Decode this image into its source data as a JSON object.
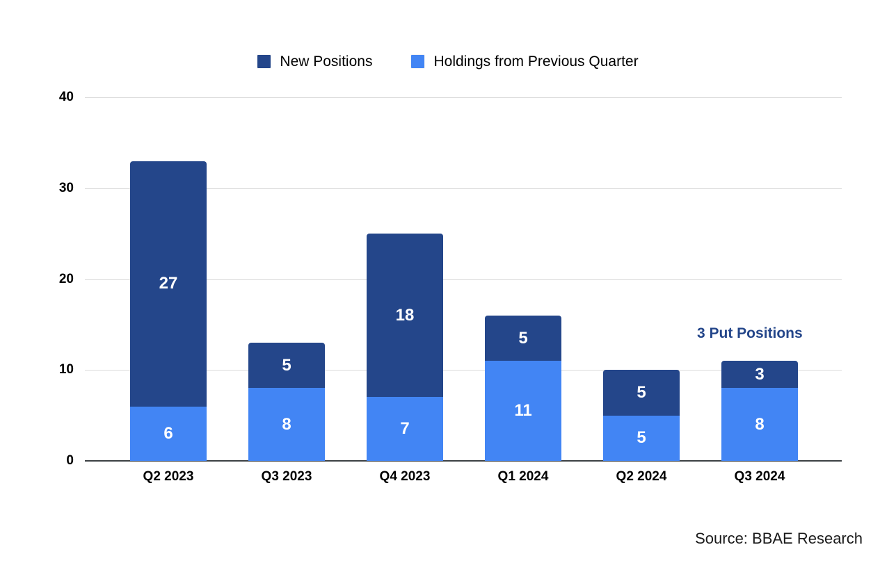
{
  "legend": {
    "entries": [
      {
        "label": "New Positions",
        "color": "#24468a"
      },
      {
        "label": "Holdings from Previous Quarter",
        "color": "#4285f4"
      }
    ]
  },
  "annotation": {
    "text": "3 Put Positions",
    "color": "#24468a"
  },
  "source": {
    "text": "Source: BBAE Research"
  },
  "chart_data": {
    "type": "bar",
    "stacked": true,
    "title": "",
    "xlabel": "",
    "ylabel": "",
    "ylim": [
      0,
      40
    ],
    "yticks": [
      0,
      10,
      20,
      30,
      40
    ],
    "ytick_labels": [
      "0",
      "10",
      "20",
      "30",
      "40"
    ],
    "grid": true,
    "legend_position": "top-center",
    "categories": [
      "Q2 2023",
      "Q3 2023",
      "Q4 2023",
      "Q1 2024",
      "Q2 2024",
      "Q3 2024"
    ],
    "series": [
      {
        "name": "Holdings from Previous Quarter",
        "color": "#4285f4",
        "values": [
          6,
          8,
          7,
          11,
          5,
          8
        ]
      },
      {
        "name": "New Positions",
        "color": "#24468a",
        "values": [
          27,
          5,
          18,
          5,
          5,
          3
        ]
      }
    ],
    "totals": [
      33,
      13,
      25,
      16,
      10,
      11
    ],
    "annotations": [
      {
        "text": "3 Put Positions",
        "color": "#24468a",
        "near_category": "Q3 2024"
      }
    ]
  }
}
